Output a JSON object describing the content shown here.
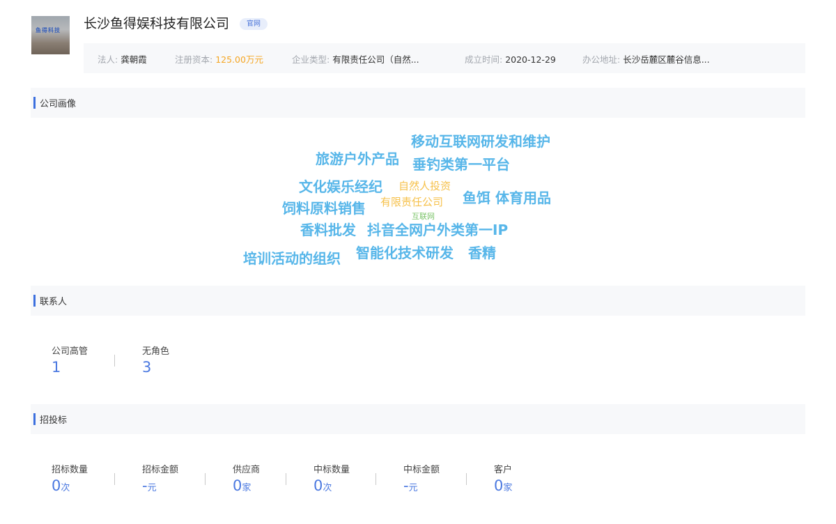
{
  "company": {
    "logo_text": "鱼得科技",
    "name": "长沙鱼得娱科技有限公司",
    "badge": "官网"
  },
  "info": {
    "legal_label": "法人:",
    "legal_value": "龚朝霞",
    "capital_label": "注册资本:",
    "capital_value": "125.00万元",
    "type_label": "企业类型:",
    "type_value": "有限责任公司（自然...",
    "date_label": "成立时间:",
    "date_value": "2020-12-29",
    "address_label": "办公地址:",
    "address_value": "长沙岳麓区麓谷信息..."
  },
  "sections": {
    "portrait": "公司画像",
    "contacts": "联系人",
    "bidding": "招投标"
  },
  "word_cloud": {
    "words": [
      "移动互联网研发和维护",
      "旅游户外产品",
      "垂钓类第一平台",
      "文化娱乐经纪",
      "自然人投资",
      "鱼饵 体育用品",
      "饲料原料销售",
      "有限责任公司",
      "互联网",
      "香料批发",
      "抖音全网户外类第一IP",
      "培训活动的组织",
      "智能化技术研发",
      "香精"
    ]
  },
  "contacts": [
    {
      "label": "公司高管",
      "value": "1"
    },
    {
      "label": "无角色",
      "value": "3"
    }
  ],
  "bidding": [
    {
      "label": "招标数量",
      "value": "0",
      "unit": "次"
    },
    {
      "label": "招标金额",
      "value": "-",
      "unit": "元"
    },
    {
      "label": "供应商",
      "value": "0",
      "unit": "家"
    },
    {
      "label": "中标数量",
      "value": "0",
      "unit": "次"
    },
    {
      "label": "中标金额",
      "value": "-",
      "unit": "元"
    },
    {
      "label": "客户",
      "value": "0",
      "unit": "家"
    }
  ]
}
